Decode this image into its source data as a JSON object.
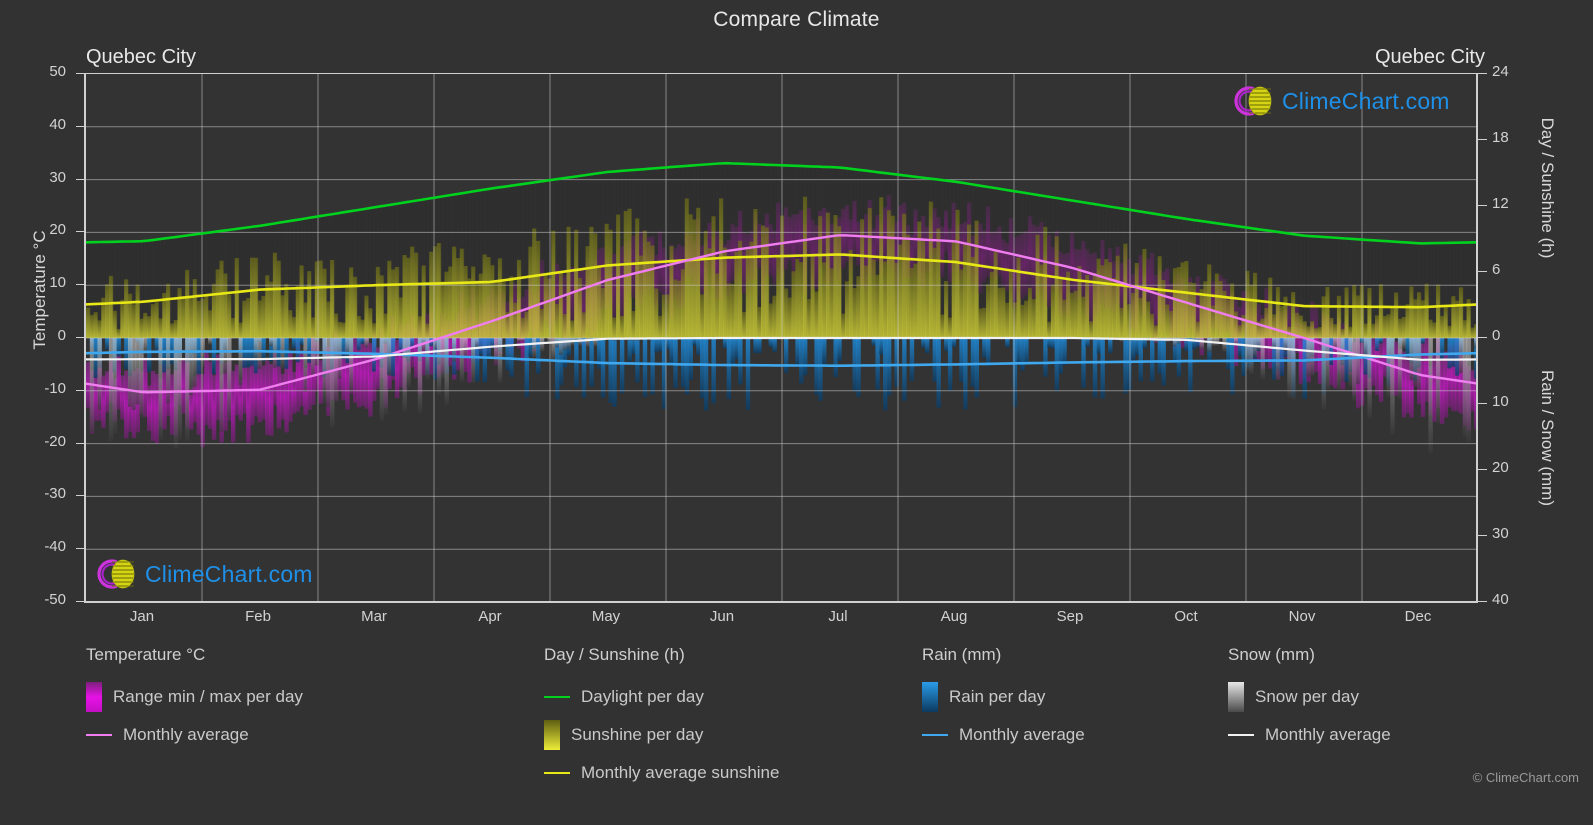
{
  "header": {
    "title": "Compare Climate",
    "city_left": "Quebec City",
    "city_right": "Quebec City"
  },
  "brand": {
    "name": "ClimeChart.com",
    "copyright": "© ClimeChart.com",
    "logo_ring_color": "#cc33dd",
    "logo_sphere_color": "#d4d415",
    "text_color": "#1f90e8"
  },
  "axes": {
    "left_label": "Temperature °C",
    "left_ticks": [
      "50",
      "40",
      "30",
      "20",
      "10",
      "0",
      "-10",
      "-20",
      "-30",
      "-40",
      "-50"
    ],
    "right_top_label": "Day / Sunshine (h)",
    "right_top_ticks": [
      "24",
      "18",
      "12",
      "6",
      "0"
    ],
    "right_bottom_label": "Rain / Snow (mm)",
    "right_bottom_ticks": [
      "0",
      "10",
      "20",
      "30",
      "40"
    ],
    "x_ticks": [
      "Jan",
      "Feb",
      "Mar",
      "Apr",
      "May",
      "Jun",
      "Jul",
      "Aug",
      "Sep",
      "Oct",
      "Nov",
      "Dec"
    ]
  },
  "legend": {
    "groups": [
      {
        "title": "Temperature °C",
        "items": [
          {
            "label": "Range min / max per day",
            "type": "box",
            "color": "#e612e6"
          },
          {
            "label": "Monthly average",
            "type": "line",
            "color": "#f07ef0"
          }
        ]
      },
      {
        "title": "Day / Sunshine (h)",
        "items": [
          {
            "label": "Daylight per day",
            "type": "line",
            "color": "#00d21e"
          },
          {
            "label": "Sunshine per day",
            "type": "box",
            "color": "#eded38"
          },
          {
            "label": "Monthly average sunshine",
            "type": "line",
            "color": "#e8e817"
          }
        ]
      },
      {
        "title": "Rain (mm)",
        "items": [
          {
            "label": "Rain per day",
            "type": "box",
            "color": "#1f8fe0"
          },
          {
            "label": "Monthly average",
            "type": "line",
            "color": "#3fa8ee"
          }
        ]
      },
      {
        "title": "Snow (mm)",
        "items": [
          {
            "label": "Snow per day",
            "type": "box",
            "color": "#cfcfcf"
          },
          {
            "label": "Monthly average",
            "type": "line",
            "color": "#f2f2f2"
          }
        ]
      }
    ]
  },
  "chart_data": {
    "type": "line",
    "title": "Compare Climate",
    "subtitle": "Quebec City",
    "xlabel": "",
    "ylabel": "Temperature °C",
    "categories": [
      "Jan",
      "Feb",
      "Mar",
      "Apr",
      "May",
      "Jun",
      "Jul",
      "Aug",
      "Sep",
      "Oct",
      "Nov",
      "Dec"
    ],
    "grid": true,
    "legend_position": "bottom",
    "axis_left": {
      "label": "Temperature °C",
      "min": -50,
      "max": 50,
      "step": 10
    },
    "axis_right_top": {
      "label": "Day / Sunshine (h)",
      "min": 0,
      "max": 24,
      "step": 6
    },
    "axis_right_bottom": {
      "label": "Rain / Snow (mm)",
      "min": 0,
      "max": 40,
      "step": 10
    },
    "series": [
      {
        "name": "Daylight per day",
        "unit": "h",
        "color": "#00d21e",
        "values": [
          8.8,
          10.2,
          11.9,
          13.6,
          15.1,
          15.9,
          15.5,
          14.2,
          12.5,
          10.8,
          9.3,
          8.6
        ]
      },
      {
        "name": "Monthly average sunshine",
        "unit": "h",
        "color": "#e8e817",
        "values": [
          3.3,
          4.4,
          4.8,
          5.1,
          6.6,
          7.3,
          7.6,
          6.9,
          5.3,
          4.1,
          2.9,
          2.8
        ]
      },
      {
        "name": "Monthly average temperature",
        "unit": "°C",
        "color": "#f07ef0",
        "values": [
          -10.3,
          -9.8,
          -4.0,
          3.2,
          11.0,
          16.4,
          19.5,
          18.3,
          13.3,
          6.6,
          0.0,
          -7.0
        ]
      },
      {
        "name": "Monthly average rain",
        "unit": "mm",
        "color": "#3fa8ee",
        "values": [
          2.1,
          2.0,
          2.4,
          3.0,
          3.8,
          4.1,
          4.2,
          4.0,
          3.7,
          3.5,
          3.4,
          2.5
        ]
      },
      {
        "name": "Monthly average snow",
        "unit": "mm",
        "color": "#f2f2f2",
        "values": [
          3.2,
          3.2,
          2.8,
          1.3,
          0.1,
          0.0,
          0.0,
          0.0,
          0.0,
          0.3,
          1.9,
          3.3
        ]
      }
    ],
    "daily_bands": [
      {
        "name": "Range min / max per day",
        "color": "#e612e6",
        "axis": "left"
      },
      {
        "name": "Sunshine per day",
        "color": "#eded38",
        "axis": "right_top"
      },
      {
        "name": "Rain per day",
        "color": "#1f8fe0",
        "axis": "right_bottom"
      },
      {
        "name": "Snow per day",
        "color": "#cfcfcf",
        "axis": "right_bottom"
      }
    ]
  }
}
